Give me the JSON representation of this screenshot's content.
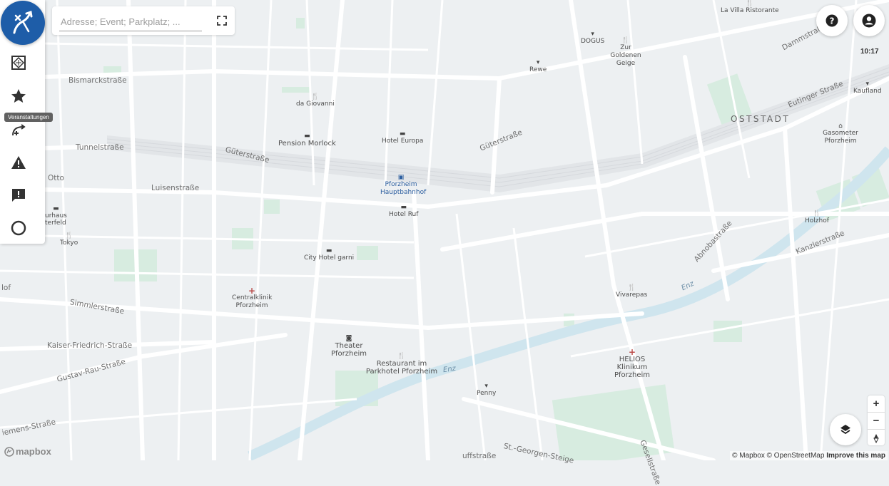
{
  "search": {
    "placeholder": "Adresse; Event; Parkplatz; ..."
  },
  "sidebar": {
    "tooltip": "Veranstaltungen",
    "tools": [
      {
        "name": "routing-icon"
      },
      {
        "name": "map-area-icon"
      },
      {
        "name": "star-icon"
      },
      {
        "name": "route-add-icon"
      },
      {
        "name": "warning-icon"
      },
      {
        "name": "feedback-icon"
      },
      {
        "name": "circle-icon"
      }
    ]
  },
  "header": {
    "time": "10:17"
  },
  "map": {
    "district": "OSTSTADT",
    "streets": [
      "Bismarckstraße",
      "Tunnelstraße",
      "Luisenstraße",
      "Güterstraße",
      "Güterstraße",
      "Simmlerstraße",
      "Kaiser-Friedrich-Straße",
      "Gustav-Rau-Straße",
      "Eutinger Straße",
      "Dammstraße",
      "Kanzlerstraße",
      "Abnobastraße",
      "St.-Georgen-Steige",
      "iemens-Straße",
      "Gesellstraße",
      "Otto",
      "lof",
      "uffstraße"
    ],
    "rivers": [
      "Enz",
      "Enz"
    ],
    "pois": {
      "la_villa": "La Villa Ristorante",
      "dogus": "DOGUS",
      "goldenen_geige": "Zur Goldenen Geige",
      "rewe": "Rewe",
      "kaufland": "Kaufland",
      "da_giovanni": "da Giovanni",
      "hotel_europa": "Hotel Europa",
      "pension_morlock": "Pension Morlock",
      "gasometer": "Gasometer Pforzheim",
      "hauptbahnhof": "Pforzheim Hauptbahnhof",
      "hotel_ruf": "Hotel Ruf",
      "gasthaus": "urhaus",
      "gasthaus2": "terfeld",
      "tokyo": "Tokyo",
      "holzhof": "Holzhof",
      "city_hotel": "City Hotel garni",
      "vivarepas": "Vivarepas",
      "centralklinik": "Centralklinik Pforzheim",
      "theater": "Theater Pforzheim",
      "restaurant_parkhotel": "Restaurant im Parkhotel Pforzheim",
      "helios": "HELIOS Klinikum Pforzheim",
      "penny": "Penny"
    }
  },
  "attribution": {
    "mapbox": "© Mapbox",
    "osm": "© OpenStreetMap",
    "improve": "Improve this map"
  },
  "brand": {
    "logo": "mapbox"
  },
  "colors": {
    "accent": "#1e5da8",
    "park": "#cdebd8",
    "water": "#c9e2ec",
    "road": "#ffffff"
  }
}
